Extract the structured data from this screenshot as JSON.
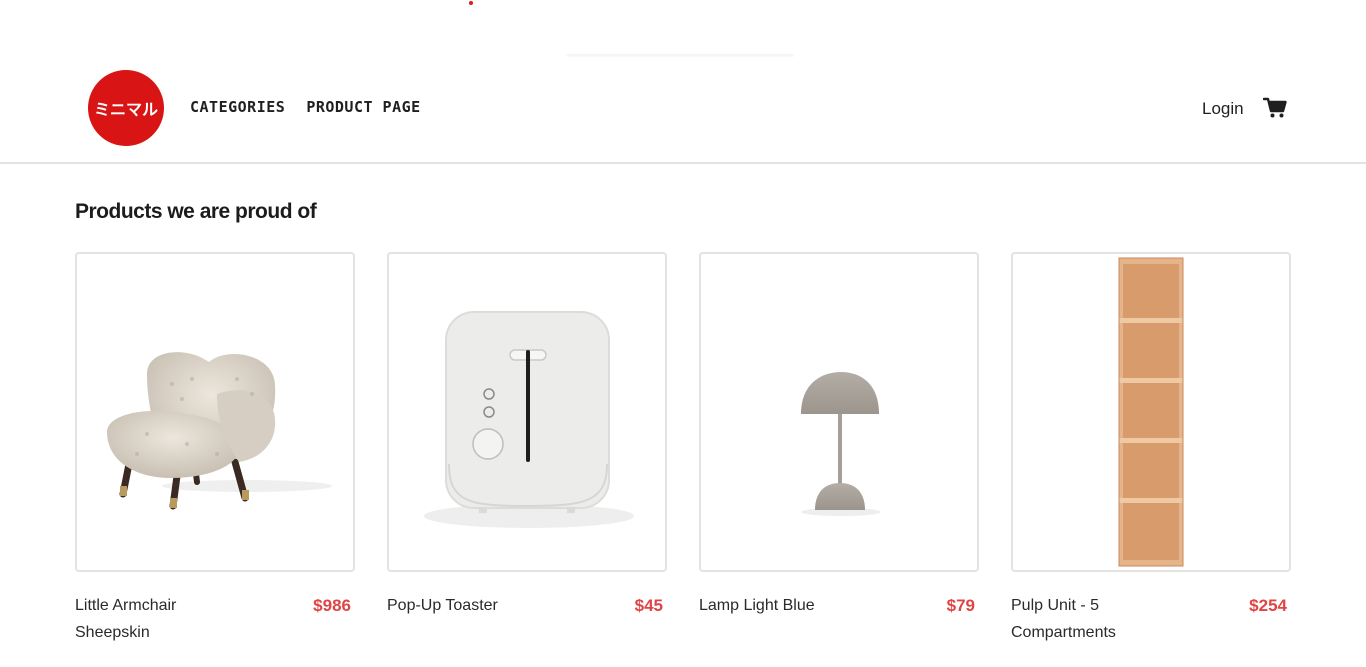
{
  "header": {
    "logo_text": "ミニマル",
    "nav": [
      {
        "label": "CATEGORIES"
      },
      {
        "label": "PRODUCT PAGE"
      }
    ],
    "login_label": "Login",
    "cart_icon": "cart-icon",
    "brand_color": "#d81414"
  },
  "main": {
    "section_title": "Products we are proud of",
    "products": [
      {
        "name": "Little Armchair Sheepskin",
        "price": "$986",
        "image": "armchair"
      },
      {
        "name": "Pop-Up Toaster",
        "price": "$45",
        "image": "toaster"
      },
      {
        "name": "Lamp Light Blue",
        "price": "$79",
        "image": "lamp"
      },
      {
        "name": "Pulp Unit - 5 Compartments",
        "price": "$254",
        "image": "shelf"
      }
    ],
    "price_color": "#e04545"
  }
}
